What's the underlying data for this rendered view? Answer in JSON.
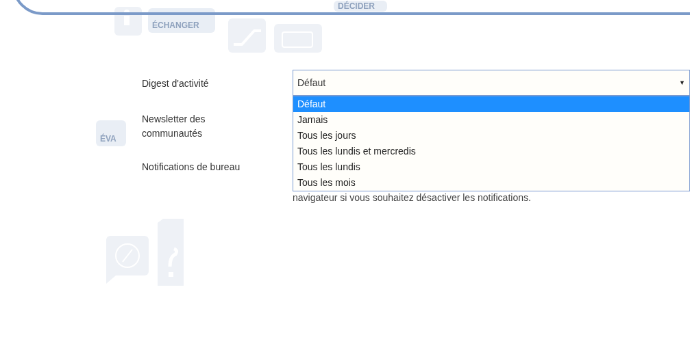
{
  "background_tiles": [
    {
      "label": "ÉCHANGER"
    },
    {
      "label": "DÉCIDER"
    },
    {
      "label": "ÉVA"
    }
  ],
  "settings": [
    {
      "label": "Digest d'activité",
      "kind": "select"
    },
    {
      "label": "Newsletter des communautés",
      "kind": "blank"
    },
    {
      "label": "Notifications de bureau",
      "kind": "note",
      "note": "navigateur si vous souhaitez désactiver les notifications."
    }
  ],
  "select": {
    "value": "Défaut",
    "caret": "▼",
    "options": [
      {
        "label": "Défaut",
        "selected": true
      },
      {
        "label": "Jamais",
        "selected": false
      },
      {
        "label": "Tous les jours",
        "selected": false
      },
      {
        "label": "Tous les lundis et mercredis",
        "selected": false
      },
      {
        "label": "Tous les lundis",
        "selected": false
      },
      {
        "label": "Tous les mois",
        "selected": false
      }
    ]
  }
}
